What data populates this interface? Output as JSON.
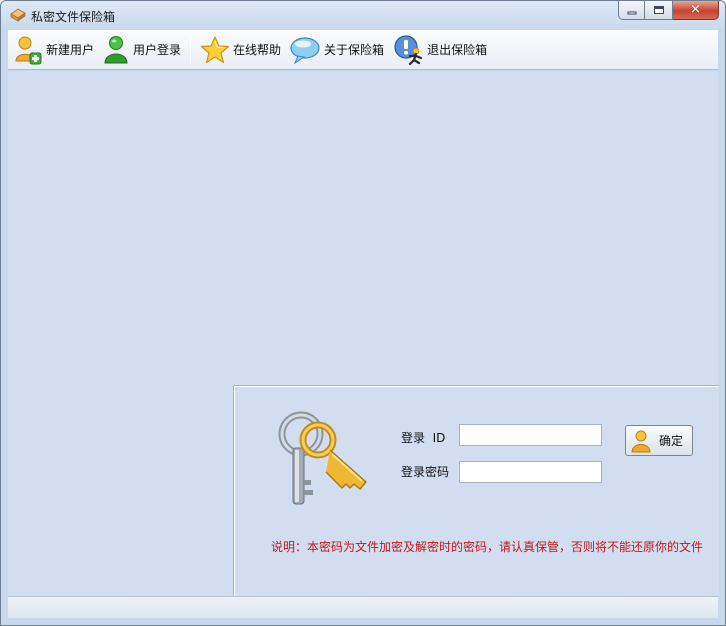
{
  "window": {
    "title": "私密文件保险箱"
  },
  "toolbar": {
    "items": [
      {
        "label": "新建用户",
        "icon": "add-user-icon"
      },
      {
        "label": "用户登录",
        "icon": "user-icon"
      },
      {
        "label": "在线帮助",
        "icon": "star-icon"
      },
      {
        "label": "关于保险箱",
        "icon": "speech-bubble-icon"
      },
      {
        "label": "退出保险箱",
        "icon": "exit-runner-icon"
      }
    ]
  },
  "login": {
    "id_label": "登录  ID",
    "id_value": "",
    "password_label": "登录密码",
    "password_value": "",
    "confirm_label": "确定",
    "note": "说明：本密码为文件加密及解密时的密码，请认真保管，否则将不能还原你的文件"
  },
  "colors": {
    "client_bg": "#d2def0",
    "note_text": "#c0181c",
    "close_button": "#c6452d"
  }
}
